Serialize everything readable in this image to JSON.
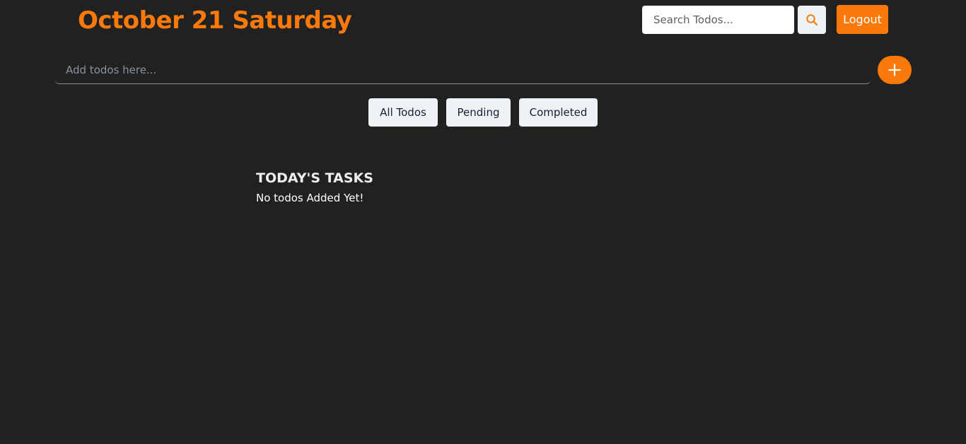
{
  "header": {
    "date_title": "October 21 Saturday",
    "search": {
      "placeholder": "Search Todos...",
      "value": "",
      "icon": "search-icon"
    },
    "logout_label": "Logout"
  },
  "add_todo": {
    "placeholder": "Add todos here...",
    "value": "",
    "icon": "plus-icon"
  },
  "filters": [
    {
      "label": "All Todos"
    },
    {
      "label": "Pending"
    },
    {
      "label": "Completed"
    }
  ],
  "tasks_section": {
    "heading": "TODAY'S TASKS",
    "empty_message": "No todos Added Yet!"
  },
  "colors": {
    "background": "#212121",
    "accent": "#f97a0a",
    "button_light": "#eef2f6"
  }
}
